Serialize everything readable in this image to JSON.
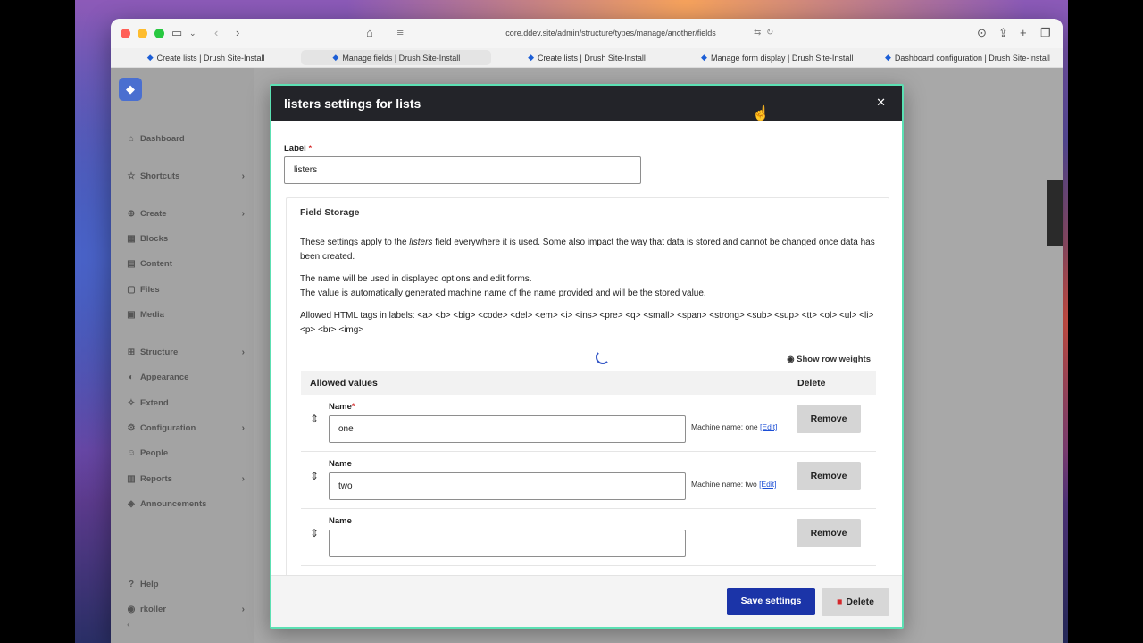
{
  "browser": {
    "url": "core.ddev.site/admin/structure/types/manage/another/fields",
    "tabs": [
      {
        "label": "Create lists | Drush Site-Install"
      },
      {
        "label": "Manage fields | Drush Site-Install"
      },
      {
        "label": "Create lists | Drush Site-Install"
      },
      {
        "label": "Manage form display | Drush Site-Install"
      },
      {
        "label": "Dashboard configuration | Drush Site-Install"
      }
    ]
  },
  "sidebar": {
    "items": [
      {
        "label": "Dashboard",
        "icon": "home-icon"
      },
      {
        "label": "Shortcuts",
        "icon": "star-icon"
      },
      {
        "label": "Create",
        "icon": "plus-icon"
      },
      {
        "label": "Blocks",
        "icon": "blocks-icon"
      },
      {
        "label": "Content",
        "icon": "content-icon"
      },
      {
        "label": "Files",
        "icon": "file-icon"
      },
      {
        "label": "Media",
        "icon": "media-icon"
      },
      {
        "label": "Structure",
        "icon": "structure-icon"
      },
      {
        "label": "Appearance",
        "icon": "appearance-icon"
      },
      {
        "label": "Extend",
        "icon": "extend-icon"
      },
      {
        "label": "Configuration",
        "icon": "wrench-icon"
      },
      {
        "label": "People",
        "icon": "people-icon"
      },
      {
        "label": "Reports",
        "icon": "reports-icon"
      },
      {
        "label": "Announcements",
        "icon": "announcements-icon"
      },
      {
        "label": "Help",
        "icon": "help-icon"
      },
      {
        "label": "rkoller",
        "icon": "user-icon"
      }
    ]
  },
  "modal": {
    "title": "listers settings for lists",
    "label_field": {
      "label": "Label",
      "required_mark": "*",
      "value": "listers"
    },
    "field_storage": {
      "legend": "Field Storage",
      "intro_pre": "These settings apply to the ",
      "intro_em": "listers",
      "intro_post": " field everywhere it is used. Some also impact the way that data is stored and cannot be changed once data has been created.",
      "name_note_1": "The name will be used in displayed options and edit forms.",
      "name_note_2": "The value is automatically generated machine name of the name provided and will be the stored value.",
      "allowed_tags": "Allowed HTML tags in labels: <a> <b> <big> <code> <del> <em> <i> <ins> <pre> <q> <small> <span> <strong> <sub> <sup> <tt> <ol> <ul> <li> <p> <br> <img>",
      "show_row_weights": "Show row weights",
      "table_headers": {
        "allowed_values": "Allowed values",
        "delete": "Delete"
      },
      "rows": [
        {
          "name_label": "Name",
          "required_mark": "*",
          "value": "one",
          "machine_name": "Machine name: one",
          "edit_link": "[Edit]",
          "remove": "Remove"
        },
        {
          "name_label": "Name",
          "value": "two",
          "machine_name": "Machine name: two",
          "edit_link": "[Edit]",
          "remove": "Remove"
        },
        {
          "name_label": "Name",
          "value": "",
          "remove": "Remove"
        }
      ]
    },
    "footer": {
      "save": "Save settings",
      "delete": "Delete"
    }
  }
}
